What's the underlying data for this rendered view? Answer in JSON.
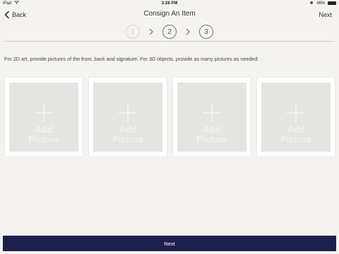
{
  "status_bar": {
    "carrier": "iPad",
    "time": "3:28 PM",
    "battery_text": "96%",
    "battery_level": 0.96
  },
  "nav": {
    "back_label": "Back",
    "title": "Consign An Item",
    "next_label": "Next"
  },
  "stepper": {
    "steps": [
      {
        "number": "1",
        "state": "inactive"
      },
      {
        "number": "2",
        "state": "active"
      },
      {
        "number": "3",
        "state": "active"
      }
    ]
  },
  "instructions": "For 2D art, provide pictures of the front, back and signature.  For 3D objects, provide as many pictures as needed:",
  "picture_slots": [
    {
      "label": "Add Picture"
    },
    {
      "label": "Add Picture"
    },
    {
      "label": "Add Picture"
    },
    {
      "label": "Add Picture"
    }
  ],
  "footer": {
    "next_label": "Next"
  },
  "colors": {
    "background": "#f4f3ef",
    "footer_bar": "#1d1f4d",
    "slot_placeholder": "#e4e4e2"
  }
}
